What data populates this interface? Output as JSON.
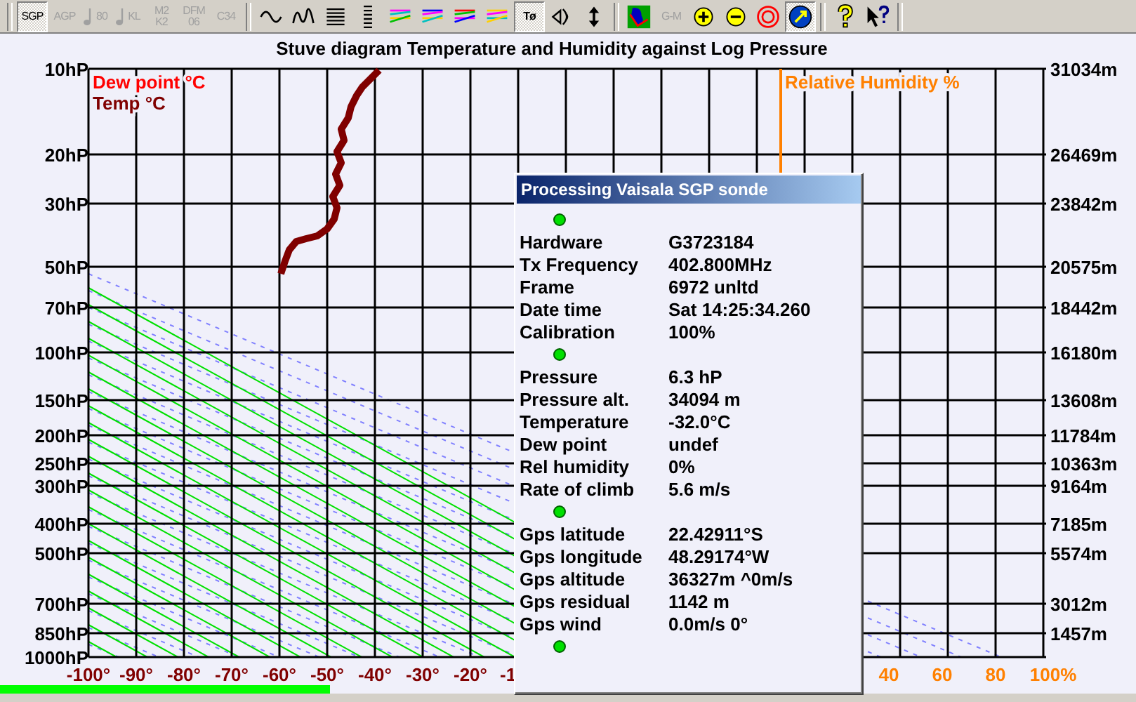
{
  "toolbar": {
    "groups": [
      {
        "buttons": [
          {
            "kind": "text",
            "label": "SGP",
            "selected": true,
            "disabled": false
          },
          {
            "kind": "text",
            "label": "AGP",
            "selected": false,
            "disabled": true
          },
          {
            "kind": "note",
            "label": "80",
            "selected": false,
            "disabled": true
          },
          {
            "kind": "note",
            "label": "KL",
            "selected": false,
            "disabled": true
          },
          {
            "kind": "text",
            "label": "M2 K2",
            "selected": false,
            "disabled": true
          },
          {
            "kind": "text",
            "label": "DFM 06",
            "selected": false,
            "disabled": true
          },
          {
            "kind": "text",
            "label": "C34",
            "selected": false,
            "disabled": true
          }
        ]
      },
      {
        "buttons": [
          {
            "kind": "icon",
            "selected": false
          },
          {
            "kind": "icon",
            "selected": false
          },
          {
            "kind": "icon",
            "selected": false
          },
          {
            "kind": "icon",
            "selected": false
          },
          {
            "kind": "icon",
            "selected": false
          },
          {
            "kind": "icon",
            "selected": false
          },
          {
            "kind": "icon",
            "selected": false
          },
          {
            "kind": "icon",
            "selected": false
          },
          {
            "kind": "text",
            "label": "Tø",
            "selected": true,
            "disabled": false
          },
          {
            "kind": "icon",
            "selected": false
          },
          {
            "kind": "icon",
            "selected": false
          }
        ]
      },
      {
        "buttons": [
          {
            "kind": "icon",
            "selected": false
          },
          {
            "kind": "text",
            "label": "G-M",
            "selected": false,
            "disabled": true
          },
          {
            "kind": "icon",
            "selected": false
          },
          {
            "kind": "icon",
            "selected": false
          },
          {
            "kind": "icon",
            "selected": false
          },
          {
            "kind": "icon",
            "selected": true
          }
        ]
      },
      {
        "buttons": [
          {
            "kind": "icon",
            "selected": false
          },
          {
            "kind": "icon",
            "selected": false
          }
        ]
      }
    ]
  },
  "chart": {
    "title": "Stuve diagram  Temperature and Humidity against Log Pressure",
    "legend": [
      {
        "label": "Dew point °C",
        "color": "#ff0000"
      },
      {
        "label": "Temp °C",
        "color": "#800000"
      }
    ],
    "humidity_label": "Relative Humidity %",
    "pressure_labels": [
      "10hP",
      "20hP",
      "30hP",
      "50hP",
      "70hP",
      "100hP",
      "150hP",
      "200hP",
      "250hP",
      "300hP",
      "400hP",
      "500hP",
      "700hP",
      "850hP",
      "1000hP"
    ],
    "altitude_labels": [
      "31034m",
      "26469m",
      "23842m",
      "20575m",
      "18442m",
      "16180m",
      "13608m",
      "11784m",
      "10363m",
      "9164m",
      "7185m",
      "5574m",
      "3012m",
      "1457m"
    ],
    "temperature_labels": [
      "-100°",
      "-90°",
      "-80°",
      "-70°",
      "-60°",
      "-50°",
      "-40°",
      "-30°",
      "-20°",
      "-1"
    ],
    "humidity_labels": [
      "40",
      "60",
      "80",
      "100%"
    ]
  },
  "popup": {
    "title": "Processing Vaisala SGP sonde",
    "sections": [
      {
        "rows": [
          {
            "label": "Hardware",
            "value": "G3723184"
          },
          {
            "label": "Tx Frequency",
            "value": "402.800MHz"
          },
          {
            "label": "Frame",
            "value": "6972 unltd"
          },
          {
            "label": "Date time",
            "value": "Sat 14:25:34.260"
          },
          {
            "label": "Calibration",
            "value": "100%"
          }
        ]
      },
      {
        "rows": [
          {
            "label": "Pressure",
            "value": "6.3 hP"
          },
          {
            "label": "Pressure alt.",
            "value": "34094 m"
          },
          {
            "label": "Temperature",
            "value": "-32.0°C"
          },
          {
            "label": "Dew point",
            "value": "undef"
          },
          {
            "label": "Rel humidity",
            "value": "0%"
          },
          {
            "label": "Rate of climb",
            "value": "5.6 m/s"
          }
        ]
      },
      {
        "rows": [
          {
            "label": "Gps latitude",
            "value": "22.42911°S"
          },
          {
            "label": "Gps longitude",
            "value": "48.29174°W"
          },
          {
            "label": "Gps altitude",
            "value": "36327m ^0m/s"
          },
          {
            "label": "Gps residual",
            "value": "1142 m"
          },
          {
            "label": "Gps wind",
            "value": "0.0m/s 0°"
          }
        ]
      }
    ]
  },
  "progress": {
    "level": 0.29
  }
}
